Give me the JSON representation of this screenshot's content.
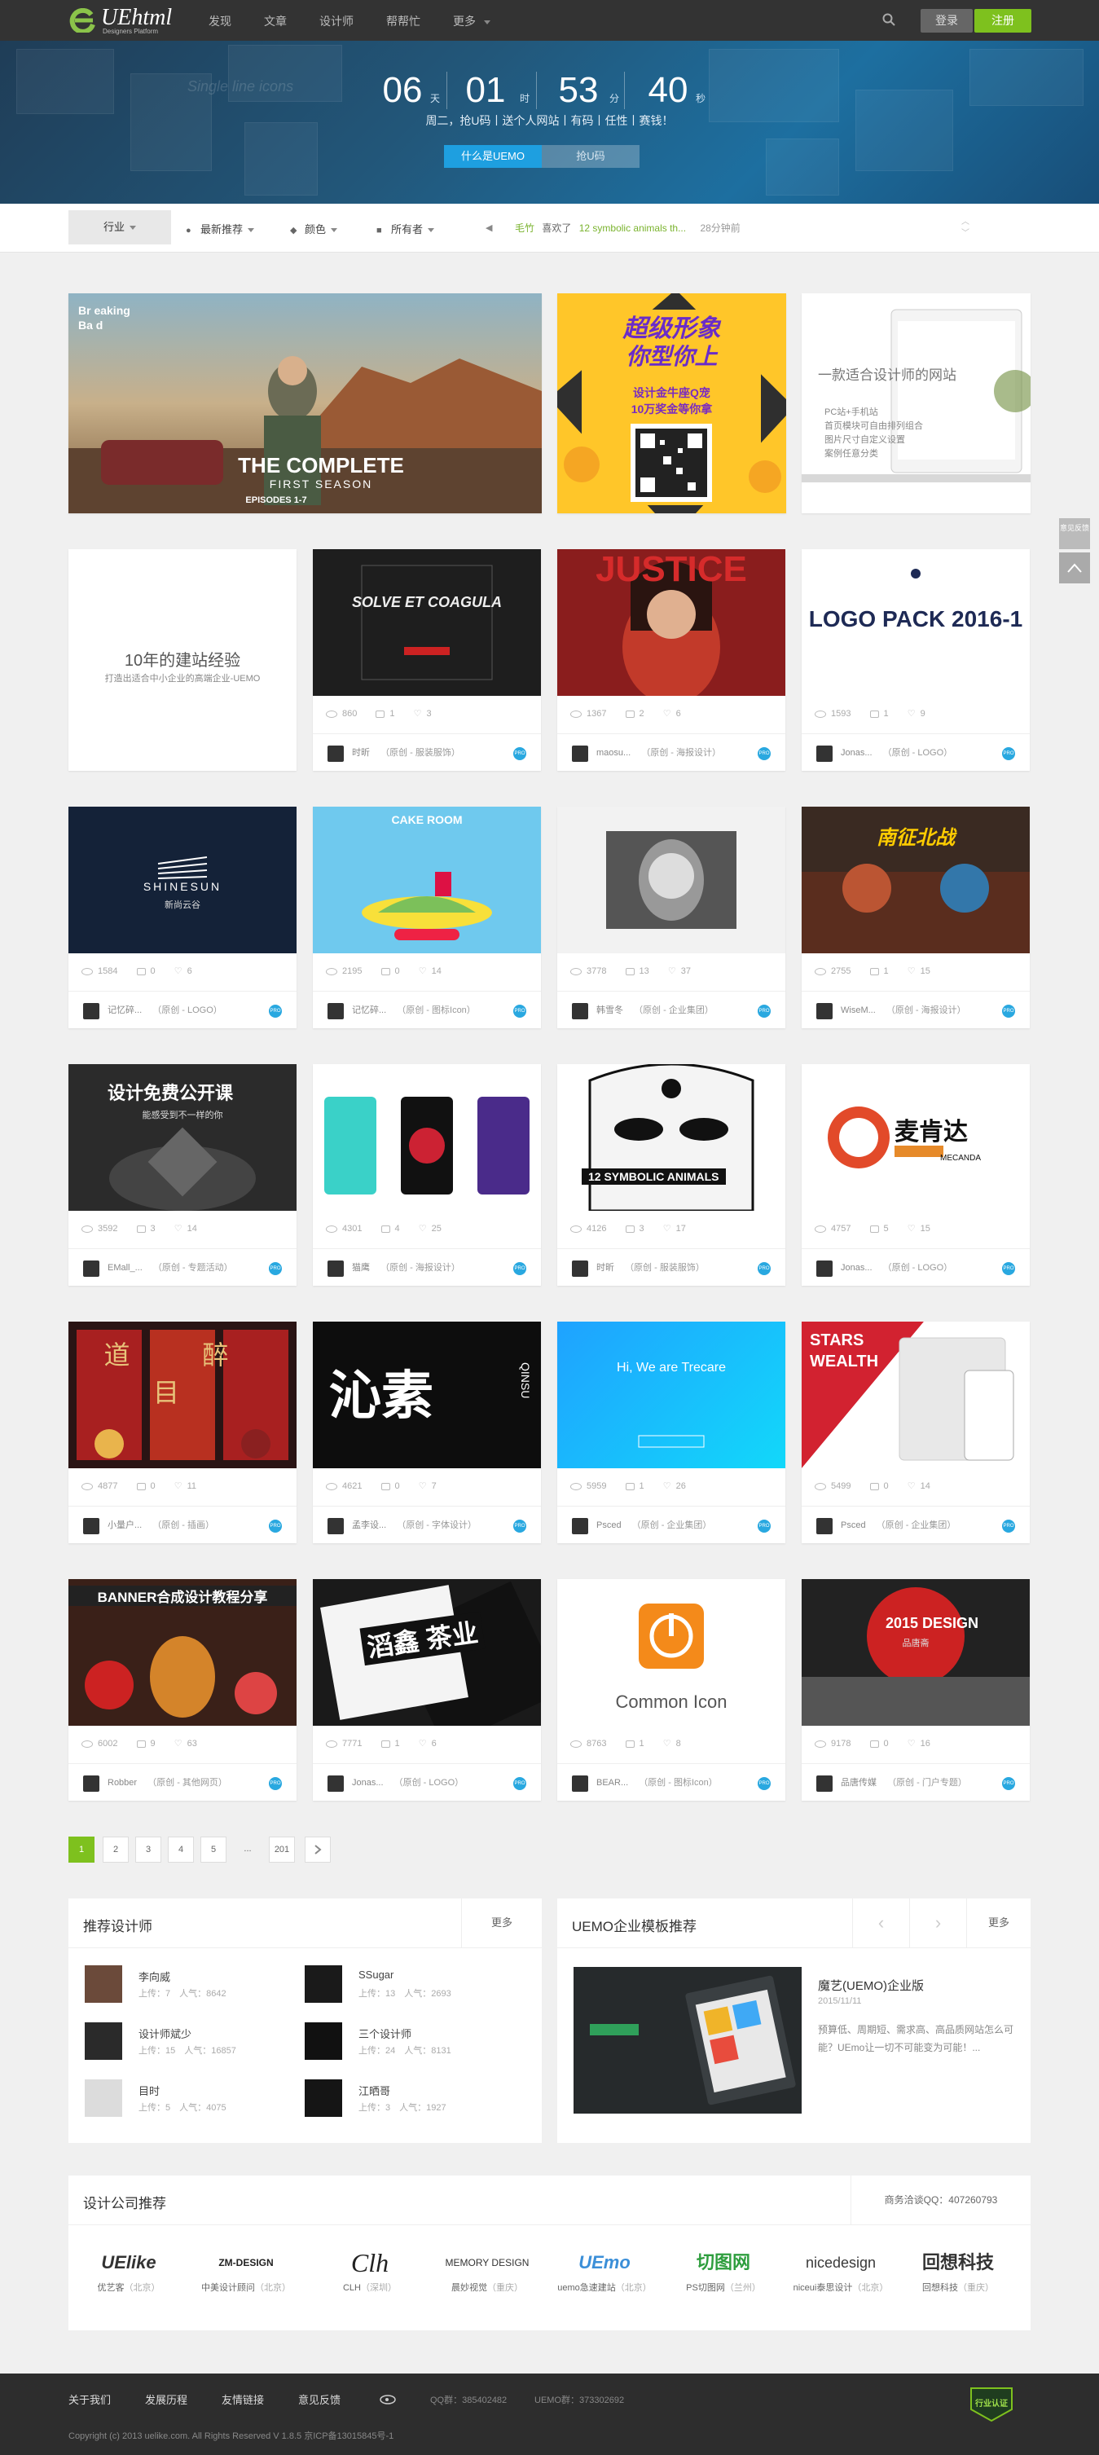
{
  "header": {
    "logo_text": "UEhtml",
    "logo_sub": "Designers Platform",
    "nav": [
      "发现",
      "文章",
      "设计师",
      "帮帮忙",
      "更多"
    ],
    "login": "登录",
    "register": "注册"
  },
  "hero": {
    "countdown": [
      {
        "value": "06",
        "unit": "天"
      },
      {
        "value": "01",
        "unit": "时"
      },
      {
        "value": "53",
        "unit": "分"
      },
      {
        "value": "40",
        "unit": "秒"
      }
    ],
    "tagline": "周二，抢U码丨送个人网站丨有码丨任性丨赛钱！",
    "btn_primary": "什么是UEMO",
    "btn_secondary": "抢U码",
    "bg_words": "Single line icons"
  },
  "filter": {
    "industry": "行业",
    "sort": "最新推荐",
    "color": "颜色",
    "owner": "所有者",
    "ticker_user": "毛竹",
    "ticker_action": "喜欢了",
    "ticker_link": "12 symbolic animals th...",
    "ticker_time": "28分钟前"
  },
  "featured": [
    {
      "title_lines": [
        "THE COMPLETE",
        "FIRST SEASON",
        "EPISODES 1-7"
      ],
      "corner": [
        "Br eaking",
        "Ba d"
      ]
    },
    {
      "title_lines": [
        "超级形象",
        "你型你上",
        "设计金牛座Q宠",
        "10万奖金等你拿"
      ]
    },
    {
      "title_lines": [
        "一款适合设计师的网站",
        "PC站+手机站",
        "首页模块可自由排列组合",
        "图片尺寸自定义设置",
        "案例任意分类"
      ]
    }
  ],
  "cards": [
    {
      "row": 0,
      "col": 0,
      "thumb_text": "10年的建站经验",
      "thumb_sub": "打造出适合中小企业的高端企业-UEMO",
      "views": "",
      "comments": "",
      "likes": "",
      "author": "",
      "category": ""
    },
    {
      "row": 0,
      "col": 1,
      "thumb_text": "SOLVE ET COAGULA",
      "views": "860",
      "comments": "1",
      "likes": "3",
      "author": "时昕",
      "category": "（原创 - 服装服饰）"
    },
    {
      "row": 0,
      "col": 2,
      "thumb_text": "JUSTICE",
      "views": "1367",
      "comments": "2",
      "likes": "6",
      "author": "maosu...",
      "category": "（原创 - 海报设计）"
    },
    {
      "row": 0,
      "col": 3,
      "thumb_text": "LOGO PACK 2016-1",
      "views": "1593",
      "comments": "1",
      "likes": "9",
      "author": "Jonas...",
      "category": "（原创 - LOGO）"
    },
    {
      "row": 1,
      "col": 0,
      "thumb_text": "SHINESUN",
      "thumb_sub": "新尚云谷",
      "views": "1584",
      "comments": "0",
      "likes": "6",
      "author": "记忆碎...",
      "category": "（原创 - LOGO）"
    },
    {
      "row": 1,
      "col": 1,
      "thumb_text": "CAKE ROOM",
      "views": "2195",
      "comments": "0",
      "likes": "14",
      "author": "记忆碎...",
      "category": "（原创 - 图标Icon）"
    },
    {
      "row": 1,
      "col": 2,
      "thumb_text": "",
      "views": "3778",
      "comments": "13",
      "likes": "37",
      "author": "韩雪冬",
      "category": "（原创 - 企业集团）"
    },
    {
      "row": 1,
      "col": 3,
      "thumb_text": "南征北战",
      "views": "2755",
      "comments": "1",
      "likes": "15",
      "author": "WiseM...",
      "category": "（原创 - 海报设计）"
    },
    {
      "row": 2,
      "col": 0,
      "thumb_text": "设计免费公开课",
      "thumb_sub": "能感受到不一样的你",
      "views": "3592",
      "comments": "3",
      "likes": "14",
      "author": "EMall_...",
      "category": "（原创 - 专题活动）"
    },
    {
      "row": 2,
      "col": 1,
      "thumb_text": "",
      "views": "4301",
      "comments": "4",
      "likes": "25",
      "author": "猫鹰",
      "category": "（原创 - 海报设计）"
    },
    {
      "row": 2,
      "col": 2,
      "thumb_text": "12 SYMBOLIC ANIMALS",
      "views": "4126",
      "comments": "3",
      "likes": "17",
      "author": "时昕",
      "category": "（原创 - 服装服饰）"
    },
    {
      "row": 2,
      "col": 3,
      "thumb_text": "麦肯达",
      "thumb_sub": "MECANDA",
      "views": "4757",
      "comments": "5",
      "likes": "15",
      "author": "Jonas...",
      "category": "（原创 - LOGO）"
    },
    {
      "row": 3,
      "col": 0,
      "thumb_text": "道 醉 目",
      "views": "4877",
      "comments": "0",
      "likes": "11",
      "author": "小量户...",
      "category": "（原创 - 插画）"
    },
    {
      "row": 3,
      "col": 1,
      "thumb_text": "沁素",
      "thumb_sub": "QINSU",
      "views": "4621",
      "comments": "0",
      "likes": "7",
      "author": "孟李设...",
      "category": "（原创 - 字体设计）"
    },
    {
      "row": 3,
      "col": 2,
      "thumb_text": "Hi, We are Trecare",
      "views": "5959",
      "comments": "1",
      "likes": "26",
      "author": "Psced",
      "category": "（原创 - 企业集团）"
    },
    {
      "row": 3,
      "col": 3,
      "thumb_text": "STARS WEALTH",
      "views": "5499",
      "comments": "0",
      "likes": "14",
      "author": "Psced",
      "category": "（原创 - 企业集团）"
    },
    {
      "row": 4,
      "col": 0,
      "thumb_text": "BANNER合成设计教程分享",
      "views": "6002",
      "comments": "9",
      "likes": "63",
      "author": "Robber",
      "category": "（原创 - 其他网页）"
    },
    {
      "row": 4,
      "col": 1,
      "thumb_text": "滔鑫 茶业",
      "views": "7771",
      "comments": "1",
      "likes": "6",
      "author": "Jonas...",
      "category": "（原创 - LOGO）"
    },
    {
      "row": 4,
      "col": 2,
      "thumb_text": "Common Icon",
      "views": "8763",
      "comments": "1",
      "likes": "8",
      "author": "BEAR...",
      "category": "（原创 - 图标Icon）"
    },
    {
      "row": 4,
      "col": 3,
      "thumb_text": "2015 DESIGN",
      "thumb_sub": "品唐斋",
      "views": "9178",
      "comments": "0",
      "likes": "16",
      "author": "品唐传媒",
      "category": "（原创 - 门户专题）"
    }
  ],
  "pagination": [
    "1",
    "2",
    "3",
    "4",
    "5",
    "...",
    "201"
  ],
  "designers": {
    "title": "推荐设计师",
    "more": "更多",
    "items": [
      {
        "name": "李向威",
        "stats": "上传：7　人气：8642"
      },
      {
        "name": "SSugar",
        "stats": "上传：13　人气：2693"
      },
      {
        "name": "设计师斌少",
        "stats": "上传：15　人气：16857"
      },
      {
        "name": "三个设计师",
        "stats": "上传：24　人气：8131"
      },
      {
        "name": "目时",
        "stats": "上传：5　人气：4075"
      },
      {
        "name": "江晒哥",
        "stats": "上传：3　人气：1927"
      }
    ]
  },
  "template": {
    "title": "UEMO企业模板推荐",
    "more": "更多",
    "name": "魔艺(UEMO)企业版",
    "date": "2015/11/11",
    "desc": "预算低、周期短、需求高、高品质网站怎么可能？UEmo让一切不可能变为可能！..."
  },
  "companies": {
    "title": "设计公司推荐",
    "contact": "商务洽谈QQ：407260793",
    "items": [
      {
        "logo": "UElike",
        "name": "优艺客",
        "city": "（北京）"
      },
      {
        "logo": "ZM-DESIGN",
        "name": "中美设计顾问",
        "city": "（北京）"
      },
      {
        "logo": "Clh",
        "name": "CLH",
        "city": "（深圳）"
      },
      {
        "logo": "MEMORY DESIGN",
        "name": "晨妙视觉",
        "city": "（重庆）"
      },
      {
        "logo": "UEmo",
        "name": "uemo急速建站",
        "city": "（北京）"
      },
      {
        "logo": "切图网",
        "name": "PS切图网",
        "city": "（兰州）"
      },
      {
        "logo": "nicedesign",
        "name": "niceui泰思设计",
        "city": "（北京）"
      },
      {
        "logo": "回想科技",
        "name": "回想科技",
        "city": "（重庆）"
      }
    ]
  },
  "footer": {
    "links": [
      "关于我们",
      "发展历程",
      "友情链接",
      "意见反馈"
    ],
    "qq1": "QQ群：385402482",
    "qq2": "UEMO群：373302692",
    "copyright": "Copyright (c) 2013 uelike.com. All Rights Reserved V 1.8.5 京ICP备13015845号-1",
    "badge": "行业认证"
  },
  "side": {
    "label": "意见反馈"
  }
}
